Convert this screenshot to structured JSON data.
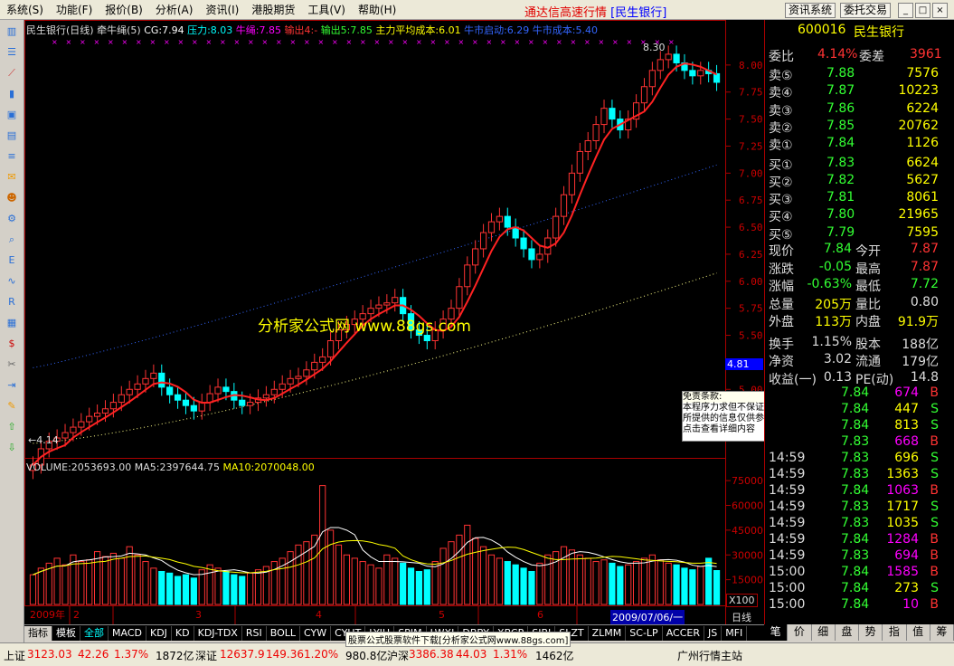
{
  "menu": [
    "系统(S)",
    "功能(F)",
    "报价(B)",
    "分析(A)",
    "资讯(I)",
    "港股期货",
    "工具(V)",
    "帮助(H)"
  ],
  "app_title": "通达信高速行情",
  "app_subtitle": "[民生银行]",
  "top_buttons": {
    "news": "资讯系统",
    "trade": "委托交易"
  },
  "window_buttons": [
    "_",
    "□",
    "×"
  ],
  "toolbar_icons": [
    "chart-icon",
    "list-icon",
    "line-icon",
    "bar-icon",
    "window-icon",
    "table-icon",
    "text-icon",
    "mail-icon",
    "people-icon",
    "gear-icon",
    "search-icon",
    "etf-icon",
    "wave-icon",
    "rsi-icon",
    "layout-icon",
    "dollar-icon",
    "tool-icon",
    "exit-icon",
    "pen-icon",
    "up-arrow-icon",
    "down-arrow-icon"
  ],
  "indicator_line": {
    "stock": "民生银行(日线)",
    "formula": "牵牛绳(5)",
    "cg": "CG:7.94",
    "pressure": "压力:8.03",
    "bull_rope": "牛绳:7.85",
    "out4": "输出4:-",
    "out5": "输出5:7.85",
    "main_cost": "主力平均成本:6.01",
    "bull_start": "牛市启动:6.29",
    "bull_cost": "牛市成本:5.40"
  },
  "high_label": "8.30",
  "low_label": "←4.14",
  "price_marker": "4.81",
  "watermark": "分析家公式网 www.88gs.com",
  "disclaimer": {
    "title": "免责条款:",
    "line1": "本程序力求但不保证数据的完全准确,",
    "line2": "所提供的信息仅供参考",
    "line3": "点击查看详细内容"
  },
  "volume_line": {
    "volume": "VOLUME:2053693.00",
    "ma5": "MA5:2397644.75",
    "ma10": "MA10:2070048.00"
  },
  "volume_axis": [
    "75000",
    "60000",
    "45000",
    "30000",
    "15000"
  ],
  "volume_unit": "X100",
  "date_labels": [
    "2009年",
    "2",
    "3",
    "4",
    "5",
    "6"
  ],
  "current_date": "2009/07/06/一",
  "period": "日线",
  "indicator_tabs": [
    "指标",
    "模板",
    "全部",
    "MACD",
    "KDJ",
    "KD",
    "KDJ-TDX",
    "RSI",
    "BOLL",
    "CYW",
    "CYHT",
    "LYJH",
    "SPJM",
    "LWXJ",
    "DBBY",
    "XBCP",
    "SJBJ",
    "SLZT",
    "ZLMM",
    "SC-LP",
    "ACCER",
    "JS",
    "MFI"
  ],
  "footer_ad": "股票公式股票软件下载[分析家公式网www.88gs.com]",
  "right_tabs": [
    "笔",
    "价",
    "细",
    "盘",
    "势",
    "指",
    "值",
    "筹"
  ],
  "quote": {
    "code": "600016",
    "name": "民生银行",
    "weibi": {
      "label": "委比",
      "value": "4.14%",
      "label2": "委差",
      "value2": "3961"
    },
    "sell": [
      {
        "label": "卖⑤",
        "price": "7.88",
        "vol": "7576"
      },
      {
        "label": "卖④",
        "price": "7.87",
        "vol": "10223"
      },
      {
        "label": "卖③",
        "price": "7.86",
        "vol": "6224"
      },
      {
        "label": "卖②",
        "price": "7.85",
        "vol": "20762"
      },
      {
        "label": "卖①",
        "price": "7.84",
        "vol": "1126"
      }
    ],
    "buy": [
      {
        "label": "买①",
        "price": "7.83",
        "vol": "6624"
      },
      {
        "label": "买②",
        "price": "7.82",
        "vol": "5627"
      },
      {
        "label": "买③",
        "price": "7.81",
        "vol": "8061"
      },
      {
        "label": "买④",
        "price": "7.80",
        "vol": "21965"
      },
      {
        "label": "买⑤",
        "price": "7.79",
        "vol": "7595"
      }
    ],
    "stats": [
      {
        "l1": "现价",
        "v1": "7.84",
        "l2": "今开",
        "v2": "7.87"
      },
      {
        "l1": "涨跌",
        "v1": "-0.05",
        "l2": "最高",
        "v2": "7.87"
      },
      {
        "l1": "涨幅",
        "v1": "-0.63%",
        "l2": "最低",
        "v2": "7.72"
      },
      {
        "l1": "总量",
        "v1": "205万",
        "l2": "量比",
        "v2": "0.80"
      },
      {
        "l1": "外盘",
        "v1": "113万",
        "l2": "内盘",
        "v2": "91.9万"
      }
    ],
    "stats2": [
      {
        "l1": "换手",
        "v1": "1.15%",
        "l2": "股本",
        "v2": "188亿"
      },
      {
        "l1": "净资",
        "v1": "3.02",
        "l2": "流通",
        "v2": "179亿"
      },
      {
        "l1": "收益(一)",
        "v1": "0.13",
        "l2": "PE(动)",
        "v2": "14.8"
      }
    ],
    "ticks": [
      {
        "t": "",
        "p": "7.84",
        "v": "674",
        "s": "B"
      },
      {
        "t": "",
        "p": "7.84",
        "v": "447",
        "s": "S"
      },
      {
        "t": "",
        "p": "7.84",
        "v": "813",
        "s": "S"
      },
      {
        "t": "",
        "p": "7.83",
        "v": "668",
        "s": "B"
      },
      {
        "t": "14:59",
        "p": "7.83",
        "v": "696",
        "s": "S"
      },
      {
        "t": "14:59",
        "p": "7.83",
        "v": "1363",
        "s": "S"
      },
      {
        "t": "14:59",
        "p": "7.84",
        "v": "1063",
        "s": "B"
      },
      {
        "t": "14:59",
        "p": "7.83",
        "v": "1717",
        "s": "S"
      },
      {
        "t": "14:59",
        "p": "7.83",
        "v": "1035",
        "s": "S"
      },
      {
        "t": "14:59",
        "p": "7.84",
        "v": "1284",
        "s": "B"
      },
      {
        "t": "14:59",
        "p": "7.83",
        "v": "694",
        "s": "B"
      },
      {
        "t": "15:00",
        "p": "7.84",
        "v": "1585",
        "s": "B"
      },
      {
        "t": "15:00",
        "p": "7.84",
        "v": "273",
        "s": "S"
      },
      {
        "t": "15:00",
        "p": "7.84",
        "v": "10",
        "s": "B"
      }
    ]
  },
  "status": {
    "sh_label": "上证",
    "sh": "3123.03",
    "sh_chg": "42.26",
    "sh_pct": "1.37%",
    "sh_amt": "1872亿",
    "sz_label": "深证",
    "sz": "12637.9",
    "sz_chg": "149.36",
    "sz_pct": "1.20%",
    "sz_amt": "980.8亿",
    "hs_label": "沪深",
    "hs": "3386.38",
    "hs_chg": "44.03",
    "hs_pct": "1.31%",
    "hs_amt": "1462亿",
    "site": "广州行情主站"
  },
  "chart_data": {
    "type": "candlestick",
    "ylim": [
      4.5,
      8.25
    ],
    "y_ticks": [
      "8.00",
      "7.75",
      "7.50",
      "7.25",
      "7.00",
      "6.75",
      "6.50",
      "6.25",
      "6.00",
      "5.75",
      "5.50",
      "5.25",
      "5.00",
      "4.75"
    ],
    "close": [
      4.3,
      4.45,
      4.52,
      4.55,
      4.6,
      4.65,
      4.7,
      4.75,
      4.78,
      4.82,
      4.88,
      4.95,
      5.0,
      5.05,
      5.1,
      5.15,
      5.02,
      4.95,
      4.9,
      4.85,
      4.8,
      4.88,
      4.96,
      5.02,
      4.98,
      4.9,
      4.85,
      4.88,
      4.92,
      4.95,
      5.0,
      5.05,
      5.1,
      5.12,
      5.18,
      5.25,
      5.3,
      5.45,
      5.55,
      5.6,
      5.65,
      5.7,
      5.75,
      5.78,
      5.8,
      5.85,
      5.7,
      5.55,
      5.5,
      5.45,
      5.55,
      5.65,
      5.75,
      5.95,
      6.15,
      6.3,
      6.45,
      6.55,
      6.6,
      6.5,
      6.4,
      6.3,
      6.2,
      6.25,
      6.4,
      6.6,
      6.8,
      7.0,
      7.2,
      7.3,
      7.45,
      7.6,
      7.5,
      7.4,
      7.5,
      7.65,
      7.8,
      7.95,
      8.05,
      8.1,
      8.02,
      7.95,
      7.9,
      7.95,
      7.92,
      7.84
    ],
    "volume": [
      18000,
      22000,
      25000,
      28000,
      24000,
      30000,
      26000,
      27000,
      32000,
      29000,
      31000,
      28000,
      35000,
      30000,
      26000,
      22000,
      20000,
      19000,
      17000,
      18000,
      16000,
      21000,
      24000,
      22000,
      20000,
      18000,
      17000,
      19000,
      21000,
      23000,
      26000,
      28000,
      32000,
      36000,
      38000,
      42000,
      72000,
      45000,
      36000,
      30000,
      28000,
      26000,
      24000,
      22000,
      30000,
      28000,
      25000,
      22000,
      20000,
      21000,
      26000,
      34000,
      38000,
      42000,
      48000,
      40000,
      35000,
      30000,
      28000,
      26000,
      24000,
      22000,
      20000,
      25000,
      30000,
      32000,
      35000,
      33000,
      30000,
      28000,
      26000,
      27000,
      25000,
      23000,
      24000,
      26000,
      28000,
      30000,
      27000,
      25000,
      24000,
      22000,
      21000,
      23000,
      28000,
      20536
    ],
    "vol_ylim": [
      0,
      80000
    ]
  }
}
